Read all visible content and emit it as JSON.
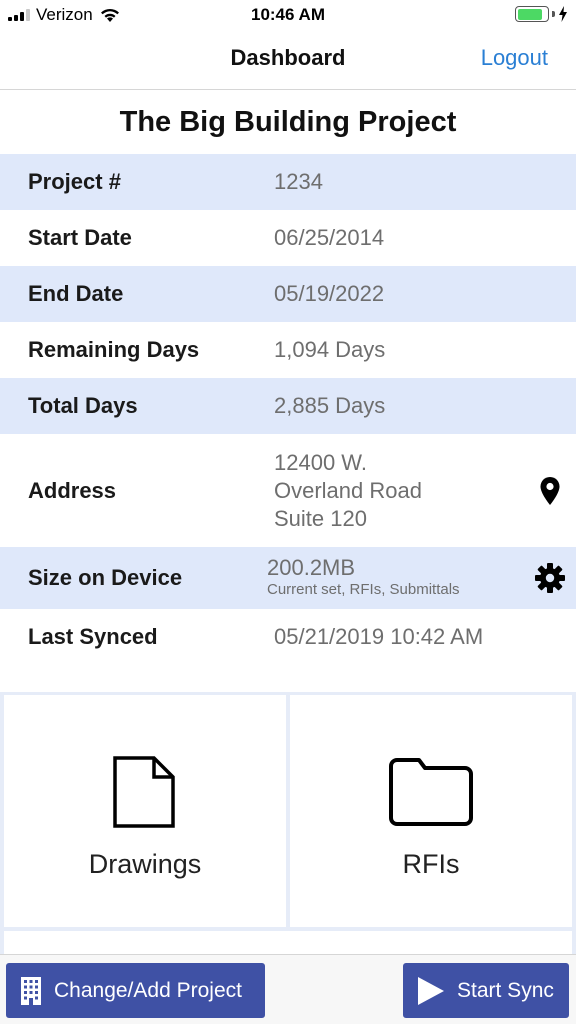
{
  "status_bar": {
    "carrier": "Verizon",
    "time": "10:46 AM",
    "battery_level": 0.85,
    "battery_color": "#4cd964"
  },
  "nav": {
    "title": "Dashboard",
    "logout_label": "Logout",
    "accent_color": "#2a7fd4"
  },
  "project": {
    "title": "The Big Building Project"
  },
  "info": {
    "project_number": {
      "label": "Project #",
      "value": "1234"
    },
    "start_date": {
      "label": "Start Date",
      "value": "06/25/2014"
    },
    "end_date": {
      "label": "End Date",
      "value": "05/19/2022"
    },
    "remaining_days": {
      "label": "Remaining Days",
      "value": "1,094 Days"
    },
    "total_days": {
      "label": "Total Days",
      "value": "2,885 Days"
    },
    "address": {
      "label": "Address",
      "lines": [
        "12400 W.",
        "Overland Road",
        "Suite 120"
      ],
      "icon": "map-pin-icon"
    },
    "size_on_device": {
      "label": "Size on Device",
      "value": "200.2MB",
      "detail": "Current set, RFIs, Submittals",
      "icon": "gear-icon"
    },
    "last_synced": {
      "label": "Last Synced",
      "value": "05/21/2019 10:42 AM"
    }
  },
  "tiles": [
    {
      "label": "Drawings",
      "icon": "document-icon"
    },
    {
      "label": "RFIs",
      "icon": "folder-icon"
    }
  ],
  "toolbar": {
    "change_project_label": "Change/Add Project",
    "change_project_icon": "building-icon",
    "start_sync_label": "Start Sync",
    "start_sync_icon": "play-icon",
    "button_color": "#3f51a5"
  }
}
